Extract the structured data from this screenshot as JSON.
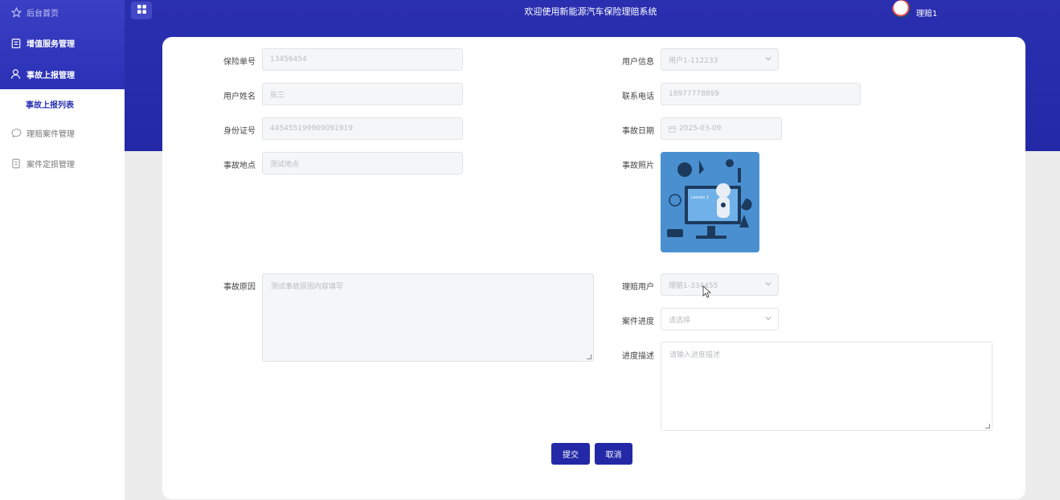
{
  "sidebar": {
    "items": [
      {
        "label": "后台首页",
        "icon": "star-icon"
      },
      {
        "label": "增值服务管理",
        "icon": "clipboard-icon"
      },
      {
        "label": "事故上报管理",
        "icon": "user-icon"
      },
      {
        "label": "事故上报列表",
        "icon": ""
      },
      {
        "label": "理赔案件管理",
        "icon": "chat-icon"
      },
      {
        "label": "案件定损管理",
        "icon": "document-icon"
      }
    ]
  },
  "header": {
    "title": "欢迎使用新能源汽车保险理赔系统",
    "user": "理赔1",
    "menu_icon": "grid-icon"
  },
  "form": {
    "policy_no": {
      "label": "保险单号",
      "value": "13456454"
    },
    "user_info": {
      "label": "用户信息",
      "value": "用户1-112233"
    },
    "user_name": {
      "label": "用户姓名",
      "value": "张三"
    },
    "phone": {
      "label": "联系电话",
      "value": "18977778899"
    },
    "id_card": {
      "label": "身份证号",
      "value": "445455199909091919"
    },
    "accident_date": {
      "label": "事故日期",
      "value": "2025-03-09"
    },
    "accident_place": {
      "label": "事故地点",
      "value": "测试地点"
    },
    "accident_photo": {
      "label": "事故照片",
      "photo_text": "Lesson 1"
    },
    "accident_reason": {
      "label": "事故原因",
      "value": "测试事故原因内容填写"
    },
    "claim_user": {
      "label": "理赔用户",
      "value": "理赔1-334455"
    },
    "case_progress": {
      "label": "案件进度",
      "placeholder": "请选择"
    },
    "progress_desc": {
      "label": "进度描述",
      "placeholder": "请输入进度描述"
    }
  },
  "buttons": {
    "submit": "提交",
    "cancel": "取消"
  },
  "colors": {
    "primary": "#2329a6",
    "sidebar_accent": "#2b31b6"
  }
}
